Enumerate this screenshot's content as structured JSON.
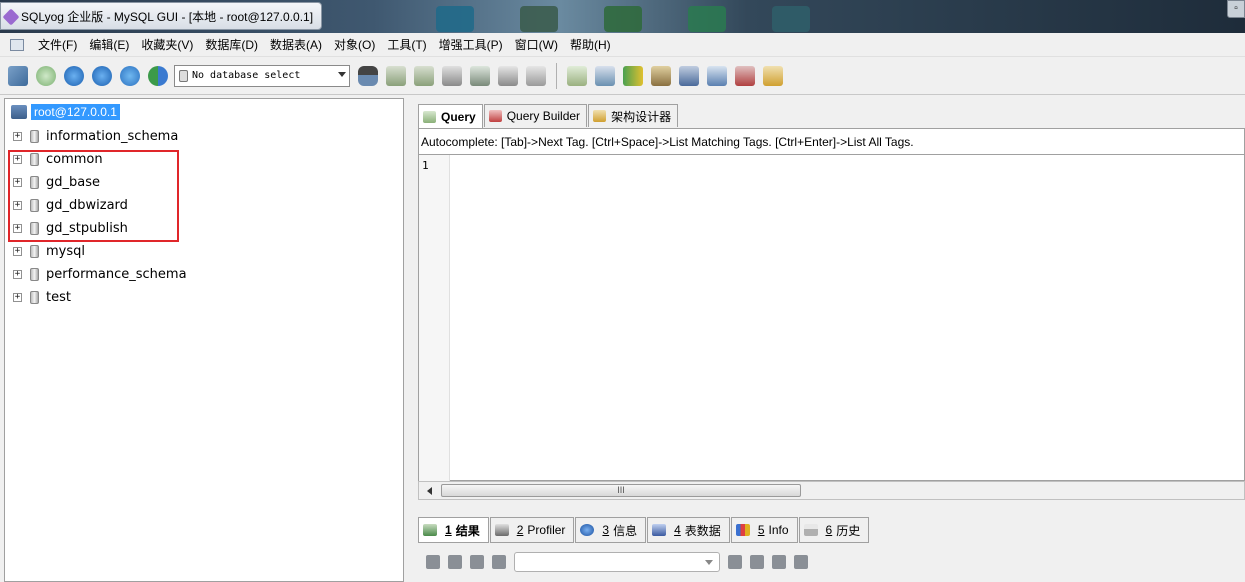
{
  "window": {
    "title": "SQLyog 企业版 - MySQL GUI - [本地 - root@127.0.0.1]"
  },
  "menu": {
    "items": [
      "文件(F)",
      "编辑(E)",
      "收藏夹(V)",
      "数据库(D)",
      "数据表(A)",
      "对象(O)",
      "工具(T)",
      "增强工具(P)",
      "窗口(W)",
      "帮助(H)"
    ]
  },
  "toolbar": {
    "db_select": "No database select"
  },
  "tree": {
    "root": "root@127.0.0.1",
    "databases": [
      "information_schema",
      "common",
      "gd_base",
      "gd_dbwizard",
      "gd_stpublish",
      "mysql",
      "performance_schema",
      "test"
    ],
    "expander": "+"
  },
  "query_tabs": [
    "Query",
    "Query Builder",
    "架构设计器"
  ],
  "autocomplete_hint": "Autocomplete: [Tab]->Next Tag. [Ctrl+Space]->List Matching Tags. [Ctrl+Enter]->List All Tags.",
  "editor": {
    "line_number": "1"
  },
  "scrollbar": {
    "grip": "III"
  },
  "result_tabs": [
    {
      "num": "1",
      "label": "结果"
    },
    {
      "num": "2",
      "label": "Profiler"
    },
    {
      "num": "3",
      "label": "信息"
    },
    {
      "num": "4",
      "label": "表数据"
    },
    {
      "num": "5",
      "label": "Info"
    },
    {
      "num": "6",
      "label": "历史"
    }
  ],
  "colors": {
    "selection": "#3399ff",
    "highlight_box": "#e0262a"
  }
}
